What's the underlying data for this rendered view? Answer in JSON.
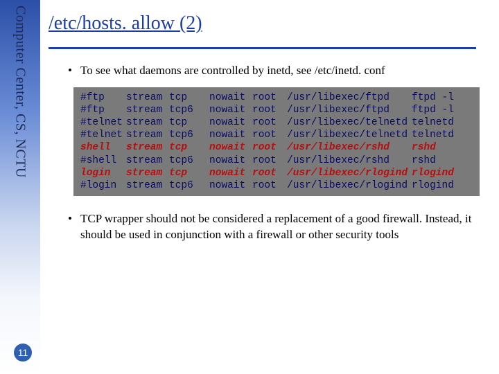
{
  "sidebar": {
    "label": "Computer Center, CS, NCTU"
  },
  "page_number": "11",
  "title": "/etc/hosts. allow (2)",
  "bullets": {
    "b1": "To see what daemons are controlled by inetd, see /etc/inetd. conf",
    "b2": "TCP wrapper should not be considered a replacement of a good firewall. Instead, it should be used in conjunction with a firewall or other security tools"
  },
  "code": {
    "rows": [
      {
        "hl": false,
        "c1": "#ftp",
        "c2": "stream",
        "c3": "tcp",
        "c4": "nowait",
        "c5": "root",
        "c6": "/usr/libexec/ftpd",
        "c7": "ftpd -l"
      },
      {
        "hl": false,
        "c1": "#ftp",
        "c2": "stream",
        "c3": "tcp6",
        "c4": "nowait",
        "c5": "root",
        "c6": "/usr/libexec/ftpd",
        "c7": "ftpd -l"
      },
      {
        "hl": false,
        "c1": "#telnet",
        "c2": "stream",
        "c3": "tcp",
        "c4": "nowait",
        "c5": "root",
        "c6": "/usr/libexec/telnetd",
        "c7": "telnetd"
      },
      {
        "hl": false,
        "c1": "#telnet",
        "c2": "stream",
        "c3": "tcp6",
        "c4": "nowait",
        "c5": "root",
        "c6": "/usr/libexec/telnetd",
        "c7": "telnetd"
      },
      {
        "hl": true,
        "c1": "shell",
        "c2": "stream",
        "c3": "tcp",
        "c4": "nowait",
        "c5": "root",
        "c6": "/usr/libexec/rshd",
        "c7": "rshd"
      },
      {
        "hl": false,
        "c1": "#shell",
        "c2": "stream",
        "c3": "tcp6",
        "c4": "nowait",
        "c5": "root",
        "c6": "/usr/libexec/rshd",
        "c7": "rshd"
      },
      {
        "hl": true,
        "c1": "login",
        "c2": "stream",
        "c3": "tcp",
        "c4": "nowait",
        "c5": "root",
        "c6": "/usr/libexec/rlogind",
        "c7": "rlogind"
      },
      {
        "hl": false,
        "c1": "#login",
        "c2": "stream",
        "c3": "tcp6",
        "c4": "nowait",
        "c5": "root",
        "c6": "/usr/libexec/rlogind",
        "c7": "rlogind"
      }
    ]
  }
}
